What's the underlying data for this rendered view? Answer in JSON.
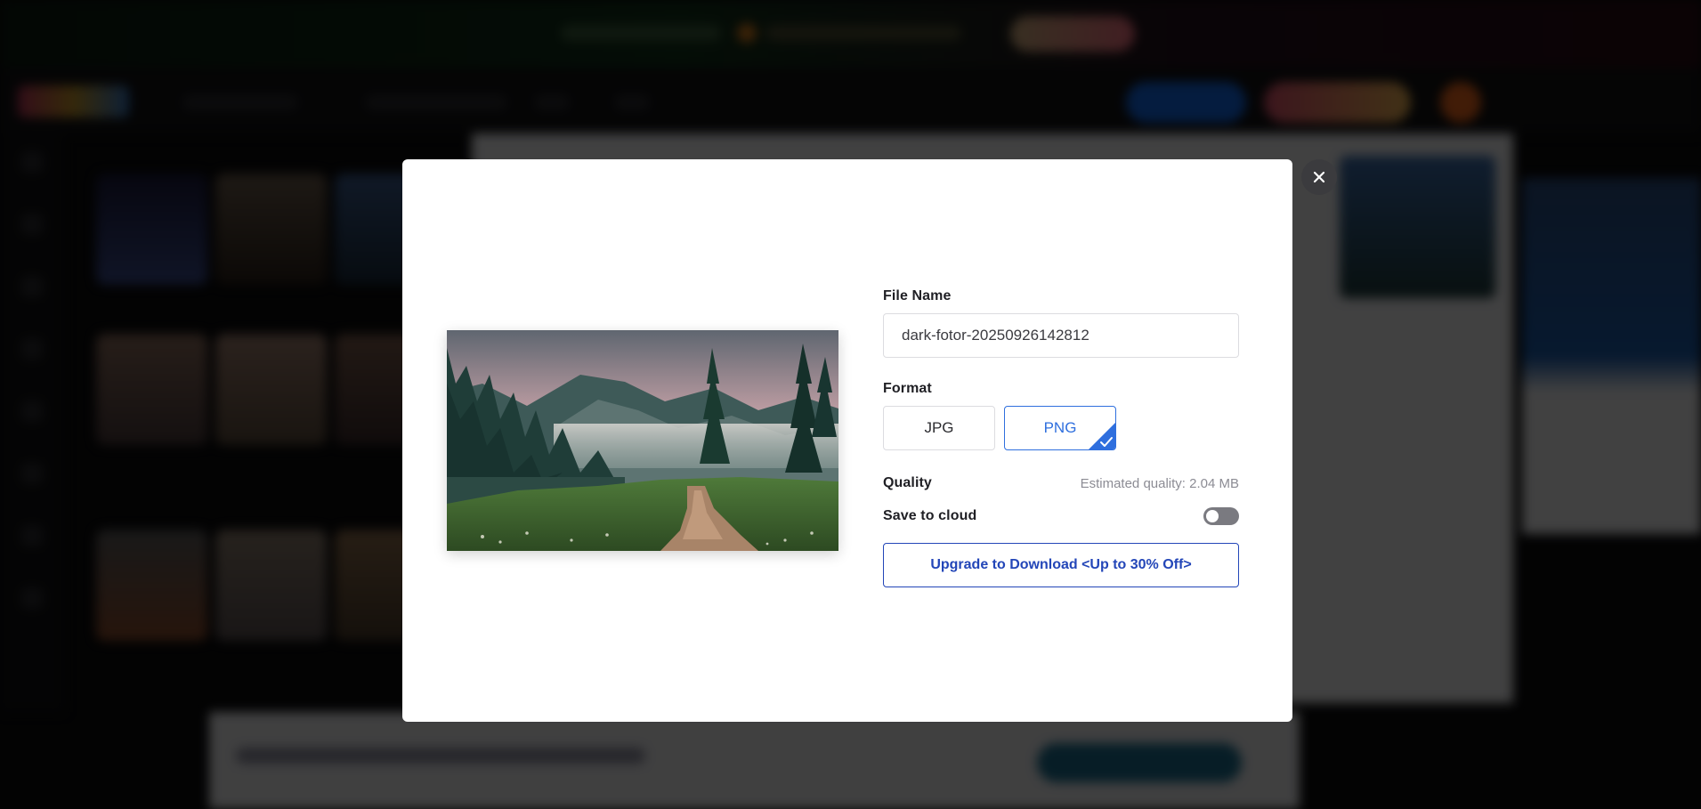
{
  "dialog": {
    "file_name": {
      "label": "File Name",
      "value": "dark-fotor-20250926142812"
    },
    "format": {
      "label": "Format",
      "options": [
        "JPG",
        "PNG"
      ],
      "selected": "PNG"
    },
    "quality": {
      "label": "Quality",
      "estimate": "Estimated quality: 2.04 MB"
    },
    "save_to_cloud": {
      "label": "Save to cloud",
      "enabled": false
    },
    "upgrade_button": "Upgrade to Download <Up to 30% Off>",
    "close_icon": "close-icon",
    "preview_image": "forest-mountain-path-photo"
  },
  "colors": {
    "accent": "#2f6fde",
    "upgrade": "#2346b8",
    "close_bg": "#3b3b3e",
    "toggle_off": "#7a7a80"
  }
}
